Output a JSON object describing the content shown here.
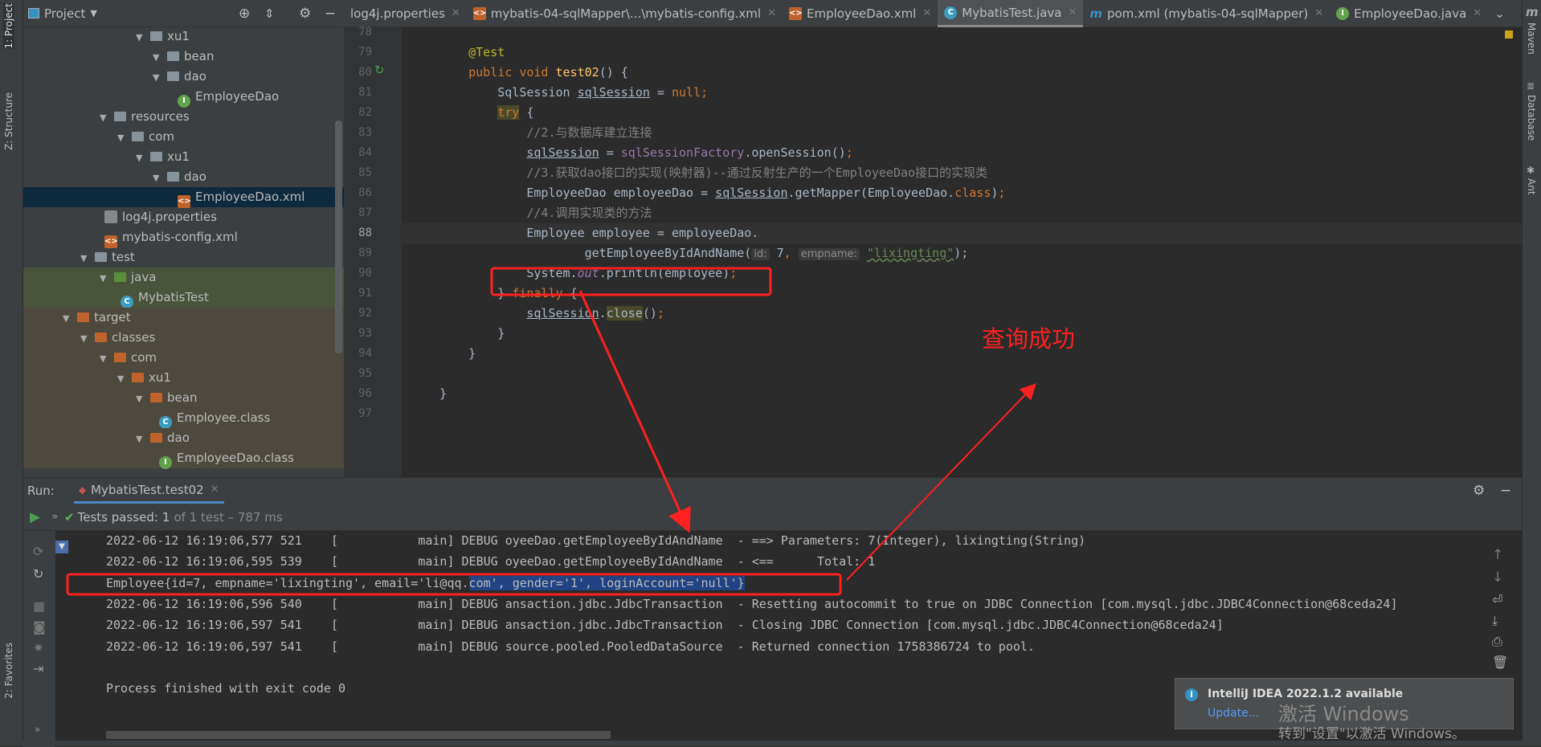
{
  "left_strip": {
    "project_tab": "1: Project",
    "structure_tab": "Z: Structure",
    "favorites_tab": "2: Favorites"
  },
  "project": {
    "title": "Project",
    "tree": [
      "xu1",
      "bean",
      "dao",
      "EmployeeDao",
      "resources",
      "com",
      "xu1",
      "dao",
      "EmployeeDao.xml",
      "log4j.properties",
      "mybatis-config.xml",
      "test",
      "java",
      "MybatisTest",
      "target",
      "classes",
      "com",
      "xu1",
      "bean",
      "Employee.class",
      "dao",
      "EmployeeDao.class"
    ]
  },
  "tabs": [
    {
      "label": "log4j.properties"
    },
    {
      "label": "mybatis-04-sqlMapper\\...\\mybatis-config.xml"
    },
    {
      "label": "EmployeeDao.xml"
    },
    {
      "label": "MybatisTest.java",
      "active": true
    },
    {
      "label": "pom.xml (mybatis-04-sqlMapper)"
    },
    {
      "label": "EmployeeDao.java"
    }
  ],
  "editor": {
    "line_numbers": [
      "78",
      "79",
      "80",
      "81",
      "82",
      "83",
      "84",
      "85",
      "86",
      "87",
      "88",
      "89",
      "90",
      "91",
      "92",
      "93",
      "94",
      "95",
      "96",
      "97"
    ],
    "lines": [
      [],
      [
        [
          "    ",
          ""
        ],
        [
          "@Test",
          "an"
        ]
      ],
      [
        [
          "    ",
          ""
        ],
        [
          "public void ",
          "kw"
        ],
        [
          "test02",
          "md"
        ],
        [
          "() {",
          ""
        ]
      ],
      [
        [
          "        SqlSession ",
          ""
        ],
        [
          "sqlSession",
          "ul"
        ],
        [
          " = ",
          ""
        ],
        [
          "null",
          "kw"
        ],
        [
          ";",
          "kw"
        ]
      ],
      [
        [
          "        ",
          ""
        ],
        [
          "try",
          "kw trybg"
        ],
        [
          " {",
          ""
        ]
      ],
      [
        [
          "            ",
          ""
        ],
        [
          "//2.与数据库建立连接",
          "cm"
        ]
      ],
      [
        [
          "            ",
          ""
        ],
        [
          "sqlSession",
          "ul"
        ],
        [
          " = ",
          ""
        ],
        [
          "sqlSessionFactory",
          "fd"
        ],
        [
          ".openSession()",
          ""
        ],
        [
          ";",
          "kw"
        ]
      ],
      [
        [
          "            ",
          ""
        ],
        [
          "//3.获取dao接口的实现(映射器)--通过反射生产的一个EmployeeDao接口的实现类",
          "cm"
        ]
      ],
      [
        [
          "            EmployeeDao employeeDao = ",
          ""
        ],
        [
          "sqlSession",
          "ul"
        ],
        [
          ".getMapper(EmployeeDao.",
          ""
        ],
        [
          "class",
          "kw"
        ],
        [
          ")",
          ""
        ],
        [
          ";",
          "kw"
        ]
      ],
      [
        [
          "            ",
          ""
        ],
        [
          "//4.调用实现类的方法",
          "cm"
        ]
      ],
      [
        [
          "            Employee employee = employeeDao.",
          ""
        ]
      ],
      [
        [
          "                    getEmployeeByIdAndName(",
          ""
        ],
        [
          "id:",
          "hint"
        ],
        [
          " 7",
          ""
        ],
        [
          ", ",
          "kw"
        ],
        [
          "empname:",
          "hint"
        ],
        [
          " ",
          ""
        ],
        [
          "\"lixingting\"",
          "st squig"
        ],
        [
          ");",
          ""
        ]
      ],
      [
        [
          "            System.",
          ""
        ],
        [
          "out",
          "fi"
        ],
        [
          ".println(employee)",
          ""
        ],
        [
          ";",
          "kw"
        ]
      ],
      [
        [
          "        } ",
          ""
        ],
        [
          "finally",
          "kw"
        ],
        [
          " {",
          ""
        ]
      ],
      [
        [
          "            ",
          ""
        ],
        [
          "sqlSession",
          "ul"
        ],
        [
          ".",
          ""
        ],
        [
          "close",
          "trybg"
        ],
        [
          "()",
          ""
        ],
        [
          ";",
          "kw"
        ]
      ],
      [
        [
          "        }",
          ""
        ]
      ],
      [
        [
          "    }",
          ""
        ]
      ],
      [],
      [
        [
          "}",
          ""
        ]
      ],
      []
    ]
  },
  "annotation": {
    "text": "查询成功",
    "color": "#ff2020"
  },
  "run": {
    "label": "Run:",
    "tab": "MybatisTest.test02",
    "tests_passed": "Tests passed:",
    "count": "1",
    "of_text": "of 1 test – 787 ms",
    "console": [
      "2022-06-12 16:19:06,577 521    [           main] DEBUG oyeeDao.getEmployeeByIdAndName  - ==> Parameters: 7(Integer), lixingting(String)",
      "2022-06-12 16:19:06,595 539    [           main] DEBUG oyeeDao.getEmployeeByIdAndName  - <==      Total: 1",
      "Employee{id=7, empname='lixingting', email='li@qq.com', gender='1', loginAccount='null'}",
      "2022-06-12 16:19:06,596 540    [           main] DEBUG ansaction.jdbc.JdbcTransaction  - Resetting autocommit to true on JDBC Connection [com.mysql.jdbc.JDBC4Connection@68ceda24]",
      "2022-06-12 16:19:06,597 541    [           main] DEBUG ansaction.jdbc.JdbcTransaction  - Closing JDBC Connection [com.mysql.jdbc.JDBC4Connection@68ceda24]",
      "2022-06-12 16:19:06,597 541    [           main] DEBUG source.pooled.PooledDataSource  - Returned connection 1758386724 to pool.",
      "",
      "Process finished with exit code 0"
    ],
    "employee_prefix": "Employee{id=7, empname='lixingting', email='li@qq.",
    "employee_selected": "com', gender='1', loginAccount='null'}"
  },
  "right_strip": {
    "maven": "Maven",
    "database": "Database",
    "ant": "Ant"
  },
  "notification": {
    "title": "IntelliJ IDEA 2022.1.2 available",
    "link": "Update...",
    "watermark1": "激活 Windows",
    "watermark2": "转到\"设置\"以激活 Windows。"
  }
}
